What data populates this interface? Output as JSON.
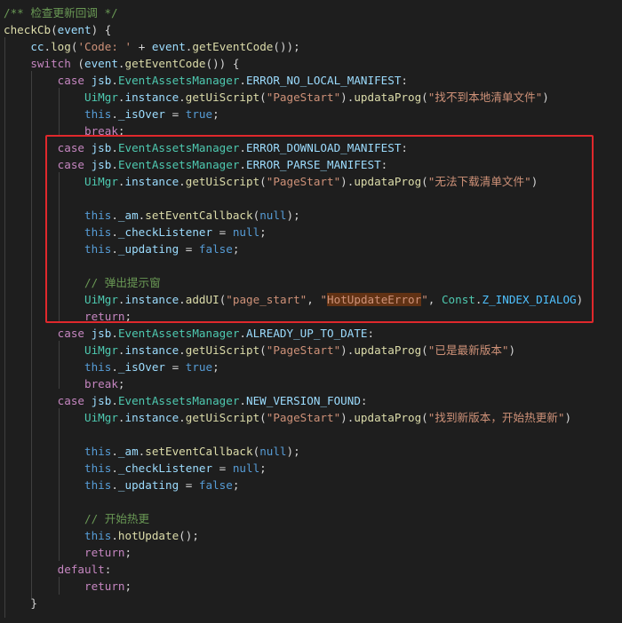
{
  "editor": {
    "lines": [
      [
        {
          "t": "/** 检查更新回调 */",
          "c": "c-comment"
        }
      ],
      [
        {
          "t": "checkCb",
          "c": "c-fn"
        },
        {
          "t": "(",
          "c": "c-plain"
        },
        {
          "t": "event",
          "c": "c-var"
        },
        {
          "t": ") {",
          "c": "c-plain"
        }
      ],
      [
        {
          "t": "    cc",
          "c": "c-var"
        },
        {
          "t": ".",
          "c": "c-plain"
        },
        {
          "t": "log",
          "c": "c-fn"
        },
        {
          "t": "(",
          "c": "c-plain"
        },
        {
          "t": "'Code: '",
          "c": "c-str"
        },
        {
          "t": " + ",
          "c": "c-plain"
        },
        {
          "t": "event",
          "c": "c-var"
        },
        {
          "t": ".",
          "c": "c-plain"
        },
        {
          "t": "getEventCode",
          "c": "c-fn"
        },
        {
          "t": "());",
          "c": "c-plain"
        }
      ],
      [
        {
          "t": "    switch",
          "c": "c-ctrl"
        },
        {
          "t": " (",
          "c": "c-plain"
        },
        {
          "t": "event",
          "c": "c-var"
        },
        {
          "t": ".",
          "c": "c-plain"
        },
        {
          "t": "getEventCode",
          "c": "c-fn"
        },
        {
          "t": "()) {",
          "c": "c-plain"
        }
      ],
      [
        {
          "t": "        case",
          "c": "c-ctrl"
        },
        {
          "t": " jsb",
          "c": "c-var"
        },
        {
          "t": ".",
          "c": "c-plain"
        },
        {
          "t": "EventAssetsManager",
          "c": "c-type"
        },
        {
          "t": ".",
          "c": "c-plain"
        },
        {
          "t": "ERROR_NO_LOCAL_MANIFEST",
          "c": "c-var"
        },
        {
          "t": ":",
          "c": "c-plain"
        }
      ],
      [
        {
          "t": "            UiMgr",
          "c": "c-type"
        },
        {
          "t": ".",
          "c": "c-plain"
        },
        {
          "t": "instance",
          "c": "c-var"
        },
        {
          "t": ".",
          "c": "c-plain"
        },
        {
          "t": "getUiScript",
          "c": "c-fn"
        },
        {
          "t": "(",
          "c": "c-plain"
        },
        {
          "t": "\"PageStart\"",
          "c": "c-str"
        },
        {
          "t": ").",
          "c": "c-plain"
        },
        {
          "t": "updataProg",
          "c": "c-fn"
        },
        {
          "t": "(",
          "c": "c-plain"
        },
        {
          "t": "\"找不到本地清单文件\"",
          "c": "c-str"
        },
        {
          "t": ")",
          "c": "c-plain"
        }
      ],
      [
        {
          "t": "            this",
          "c": "c-kw"
        },
        {
          "t": ".",
          "c": "c-plain"
        },
        {
          "t": "_isOver",
          "c": "c-var"
        },
        {
          "t": " = ",
          "c": "c-plain"
        },
        {
          "t": "true",
          "c": "c-kw"
        },
        {
          "t": ";",
          "c": "c-plain"
        }
      ],
      [
        {
          "t": "            break",
          "c": "c-ctrl"
        },
        {
          "t": ";",
          "c": "c-plain"
        }
      ],
      [
        {
          "t": "        case",
          "c": "c-ctrl"
        },
        {
          "t": " jsb",
          "c": "c-var"
        },
        {
          "t": ".",
          "c": "c-plain"
        },
        {
          "t": "EventAssetsManager",
          "c": "c-type"
        },
        {
          "t": ".",
          "c": "c-plain"
        },
        {
          "t": "ERROR_DOWNLOAD_MANIFEST",
          "c": "c-var"
        },
        {
          "t": ":",
          "c": "c-plain"
        }
      ],
      [
        {
          "t": "        case",
          "c": "c-ctrl"
        },
        {
          "t": " jsb",
          "c": "c-var"
        },
        {
          "t": ".",
          "c": "c-plain"
        },
        {
          "t": "EventAssetsManager",
          "c": "c-type"
        },
        {
          "t": ".",
          "c": "c-plain"
        },
        {
          "t": "ERROR_PARSE_MANIFEST",
          "c": "c-var"
        },
        {
          "t": ":",
          "c": "c-plain"
        }
      ],
      [
        {
          "t": "            UiMgr",
          "c": "c-type"
        },
        {
          "t": ".",
          "c": "c-plain"
        },
        {
          "t": "instance",
          "c": "c-var"
        },
        {
          "t": ".",
          "c": "c-plain"
        },
        {
          "t": "getUiScript",
          "c": "c-fn"
        },
        {
          "t": "(",
          "c": "c-plain"
        },
        {
          "t": "\"PageStart\"",
          "c": "c-str"
        },
        {
          "t": ").",
          "c": "c-plain"
        },
        {
          "t": "updataProg",
          "c": "c-fn"
        },
        {
          "t": "(",
          "c": "c-plain"
        },
        {
          "t": "\"无法下载清单文件\"",
          "c": "c-str"
        },
        {
          "t": ")",
          "c": "c-plain"
        }
      ],
      [],
      [
        {
          "t": "            this",
          "c": "c-kw"
        },
        {
          "t": ".",
          "c": "c-plain"
        },
        {
          "t": "_am",
          "c": "c-var"
        },
        {
          "t": ".",
          "c": "c-plain"
        },
        {
          "t": "setEventCallback",
          "c": "c-fn"
        },
        {
          "t": "(",
          "c": "c-plain"
        },
        {
          "t": "null",
          "c": "c-kw"
        },
        {
          "t": ");",
          "c": "c-plain"
        }
      ],
      [
        {
          "t": "            this",
          "c": "c-kw"
        },
        {
          "t": ".",
          "c": "c-plain"
        },
        {
          "t": "_checkListener",
          "c": "c-var"
        },
        {
          "t": " = ",
          "c": "c-plain"
        },
        {
          "t": "null",
          "c": "c-kw"
        },
        {
          "t": ";",
          "c": "c-plain"
        }
      ],
      [
        {
          "t": "            this",
          "c": "c-kw"
        },
        {
          "t": ".",
          "c": "c-plain"
        },
        {
          "t": "_updating",
          "c": "c-var"
        },
        {
          "t": " = ",
          "c": "c-plain"
        },
        {
          "t": "false",
          "c": "c-kw"
        },
        {
          "t": ";",
          "c": "c-plain"
        }
      ],
      [],
      [
        {
          "t": "            // 弹出提示窗",
          "c": "c-comment"
        }
      ],
      [
        {
          "t": "            UiMgr",
          "c": "c-type"
        },
        {
          "t": ".",
          "c": "c-plain"
        },
        {
          "t": "instance",
          "c": "c-var"
        },
        {
          "t": ".",
          "c": "c-plain"
        },
        {
          "t": "addUI",
          "c": "c-fn"
        },
        {
          "t": "(",
          "c": "c-plain"
        },
        {
          "t": "\"page_start\"",
          "c": "c-str"
        },
        {
          "t": ", ",
          "c": "c-plain"
        },
        {
          "t": "\"",
          "c": "c-str"
        },
        {
          "t": "HotUpdateError",
          "c": "c-str hl"
        },
        {
          "t": "\"",
          "c": "c-str"
        },
        {
          "t": ", ",
          "c": "c-plain"
        },
        {
          "t": "Const",
          "c": "c-type"
        },
        {
          "t": ".",
          "c": "c-plain"
        },
        {
          "t": "Z_INDEX_DIALOG",
          "c": "c-const"
        },
        {
          "t": ")",
          "c": "c-plain"
        }
      ],
      [
        {
          "t": "            return",
          "c": "c-ctrl"
        },
        {
          "t": ";",
          "c": "c-plain"
        }
      ],
      [
        {
          "t": "        case",
          "c": "c-ctrl"
        },
        {
          "t": " jsb",
          "c": "c-var"
        },
        {
          "t": ".",
          "c": "c-plain"
        },
        {
          "t": "EventAssetsManager",
          "c": "c-type"
        },
        {
          "t": ".",
          "c": "c-plain"
        },
        {
          "t": "ALREADY_UP_TO_DATE",
          "c": "c-var"
        },
        {
          "t": ":",
          "c": "c-plain"
        }
      ],
      [
        {
          "t": "            UiMgr",
          "c": "c-type"
        },
        {
          "t": ".",
          "c": "c-plain"
        },
        {
          "t": "instance",
          "c": "c-var"
        },
        {
          "t": ".",
          "c": "c-plain"
        },
        {
          "t": "getUiScript",
          "c": "c-fn"
        },
        {
          "t": "(",
          "c": "c-plain"
        },
        {
          "t": "\"PageStart\"",
          "c": "c-str"
        },
        {
          "t": ").",
          "c": "c-plain"
        },
        {
          "t": "updataProg",
          "c": "c-fn"
        },
        {
          "t": "(",
          "c": "c-plain"
        },
        {
          "t": "\"已是最新版本\"",
          "c": "c-str"
        },
        {
          "t": ")",
          "c": "c-plain"
        }
      ],
      [
        {
          "t": "            this",
          "c": "c-kw"
        },
        {
          "t": ".",
          "c": "c-plain"
        },
        {
          "t": "_isOver",
          "c": "c-var"
        },
        {
          "t": " = ",
          "c": "c-plain"
        },
        {
          "t": "true",
          "c": "c-kw"
        },
        {
          "t": ";",
          "c": "c-plain"
        }
      ],
      [
        {
          "t": "            break",
          "c": "c-ctrl"
        },
        {
          "t": ";",
          "c": "c-plain"
        }
      ],
      [
        {
          "t": "        case",
          "c": "c-ctrl"
        },
        {
          "t": " jsb",
          "c": "c-var"
        },
        {
          "t": ".",
          "c": "c-plain"
        },
        {
          "t": "EventAssetsManager",
          "c": "c-type"
        },
        {
          "t": ".",
          "c": "c-plain"
        },
        {
          "t": "NEW_VERSION_FOUND",
          "c": "c-var"
        },
        {
          "t": ":",
          "c": "c-plain"
        }
      ],
      [
        {
          "t": "            UiMgr",
          "c": "c-type"
        },
        {
          "t": ".",
          "c": "c-plain"
        },
        {
          "t": "instance",
          "c": "c-var"
        },
        {
          "t": ".",
          "c": "c-plain"
        },
        {
          "t": "getUiScript",
          "c": "c-fn"
        },
        {
          "t": "(",
          "c": "c-plain"
        },
        {
          "t": "\"PageStart\"",
          "c": "c-str"
        },
        {
          "t": ").",
          "c": "c-plain"
        },
        {
          "t": "updataProg",
          "c": "c-fn"
        },
        {
          "t": "(",
          "c": "c-plain"
        },
        {
          "t": "\"找到新版本，开始热更新\"",
          "c": "c-str"
        },
        {
          "t": ")",
          "c": "c-plain"
        }
      ],
      [],
      [
        {
          "t": "            this",
          "c": "c-kw"
        },
        {
          "t": ".",
          "c": "c-plain"
        },
        {
          "t": "_am",
          "c": "c-var"
        },
        {
          "t": ".",
          "c": "c-plain"
        },
        {
          "t": "setEventCallback",
          "c": "c-fn"
        },
        {
          "t": "(",
          "c": "c-plain"
        },
        {
          "t": "null",
          "c": "c-kw"
        },
        {
          "t": ");",
          "c": "c-plain"
        }
      ],
      [
        {
          "t": "            this",
          "c": "c-kw"
        },
        {
          "t": ".",
          "c": "c-plain"
        },
        {
          "t": "_checkListener",
          "c": "c-var"
        },
        {
          "t": " = ",
          "c": "c-plain"
        },
        {
          "t": "null",
          "c": "c-kw"
        },
        {
          "t": ";",
          "c": "c-plain"
        }
      ],
      [
        {
          "t": "            this",
          "c": "c-kw"
        },
        {
          "t": ".",
          "c": "c-plain"
        },
        {
          "t": "_updating",
          "c": "c-var"
        },
        {
          "t": " = ",
          "c": "c-plain"
        },
        {
          "t": "false",
          "c": "c-kw"
        },
        {
          "t": ";",
          "c": "c-plain"
        }
      ],
      [],
      [
        {
          "t": "            // 开始热更",
          "c": "c-comment"
        }
      ],
      [
        {
          "t": "            this",
          "c": "c-kw"
        },
        {
          "t": ".",
          "c": "c-plain"
        },
        {
          "t": "hotUpdate",
          "c": "c-fn"
        },
        {
          "t": "();",
          "c": "c-plain"
        }
      ],
      [
        {
          "t": "            return",
          "c": "c-ctrl"
        },
        {
          "t": ";",
          "c": "c-plain"
        }
      ],
      [
        {
          "t": "        default",
          "c": "c-ctrl"
        },
        {
          "t": ":",
          "c": "c-plain"
        }
      ],
      [
        {
          "t": "            return",
          "c": "c-ctrl"
        },
        {
          "t": ";",
          "c": "c-plain"
        }
      ],
      [
        {
          "t": "    }",
          "c": "c-plain"
        }
      ]
    ]
  },
  "highlight": {
    "annotation_color": "#e0282c"
  }
}
